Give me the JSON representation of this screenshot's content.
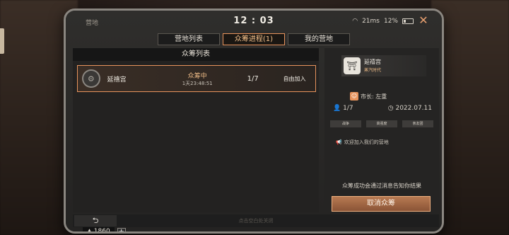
{
  "status_bar": {
    "camp_label": "营地",
    "time": "12 : 03",
    "wifi": "21ms",
    "battery": "12%"
  },
  "tabs": [
    {
      "label": "营地列表"
    },
    {
      "label": "众筹进程(1)"
    },
    {
      "label": "我的营地"
    }
  ],
  "list": {
    "header": "众筹列表",
    "row": {
      "name": "延禧宫",
      "status": "众筹中",
      "countdown": "1天23:48:51",
      "members": "1/7",
      "join_mode": "自由加入"
    }
  },
  "currency": {
    "amount": "1860",
    "plus": "+"
  },
  "detail": {
    "name": "延禧宫",
    "era": "蒸汽时代",
    "mayor": "市长: 左重",
    "members": "1/7",
    "date": "2022.07.11",
    "tags": [
      "战争",
      "高强度",
      "亲友团"
    ],
    "welcome": "欢迎加入我们的营地",
    "notice": "众筹成功会通过消息告知你结果",
    "cancel_label": "取消众筹"
  },
  "bottom": {
    "back": "⮌",
    "hint": "点击空白处关闭"
  },
  "colors": {
    "accent": "#e7935c",
    "button": "#a06a48"
  },
  "icons": [
    "wifi-icon",
    "battery-icon",
    "close-icon",
    "camp-emblem-icon",
    "temple-icon",
    "mayor-avatar-icon",
    "member-icon",
    "clock-icon",
    "megaphone-icon",
    "back-icon",
    "crowd-icon"
  ]
}
